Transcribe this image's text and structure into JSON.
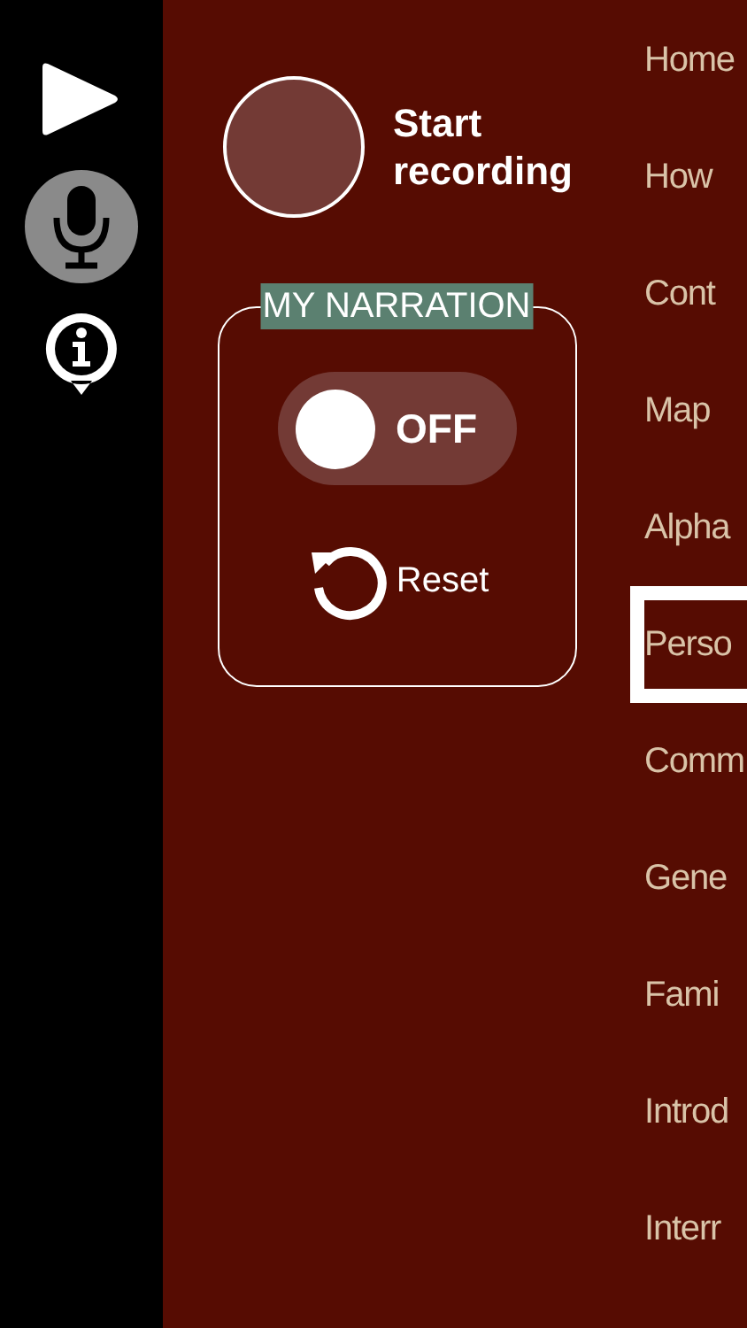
{
  "toolbar": {
    "mic_selected": true
  },
  "record": {
    "label": "Start recording"
  },
  "narration": {
    "title": "MY NARRATION",
    "on": false,
    "state_text": "OFF",
    "reset": "Reset"
  },
  "menu": [
    {
      "label": "Home",
      "selected": false
    },
    {
      "label": "How",
      "selected": false
    },
    {
      "label": "Cont",
      "selected": false
    },
    {
      "label": "Map",
      "selected": false
    },
    {
      "label": "Alpha",
      "selected": false
    },
    {
      "label": "Perso",
      "selected": true
    },
    {
      "label": "Comm",
      "selected": false
    },
    {
      "label": "Gene",
      "selected": false
    },
    {
      "label": "Fami",
      "selected": false
    },
    {
      "label": "Introd",
      "selected": false
    },
    {
      "label": "Interr",
      "selected": false
    }
  ]
}
